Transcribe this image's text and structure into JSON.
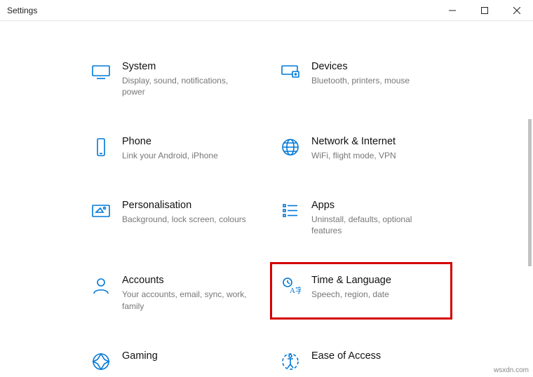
{
  "window": {
    "title": "Settings"
  },
  "categories": [
    {
      "key": "system",
      "title": "System",
      "desc": "Display, sound, notifications, power"
    },
    {
      "key": "devices",
      "title": "Devices",
      "desc": "Bluetooth, printers, mouse"
    },
    {
      "key": "phone",
      "title": "Phone",
      "desc": "Link your Android, iPhone"
    },
    {
      "key": "network",
      "title": "Network & Internet",
      "desc": "WiFi, flight mode, VPN"
    },
    {
      "key": "personalisation",
      "title": "Personalisation",
      "desc": "Background, lock screen, colours"
    },
    {
      "key": "apps",
      "title": "Apps",
      "desc": "Uninstall, defaults, optional features"
    },
    {
      "key": "accounts",
      "title": "Accounts",
      "desc": "Your accounts, email, sync, work, family"
    },
    {
      "key": "time-language",
      "title": "Time & Language",
      "desc": "Speech, region, date",
      "highlight": true
    },
    {
      "key": "gaming",
      "title": "Gaming",
      "desc": ""
    },
    {
      "key": "ease-of-access",
      "title": "Ease of Access",
      "desc": ""
    }
  ],
  "watermark": "wsxdn.com"
}
